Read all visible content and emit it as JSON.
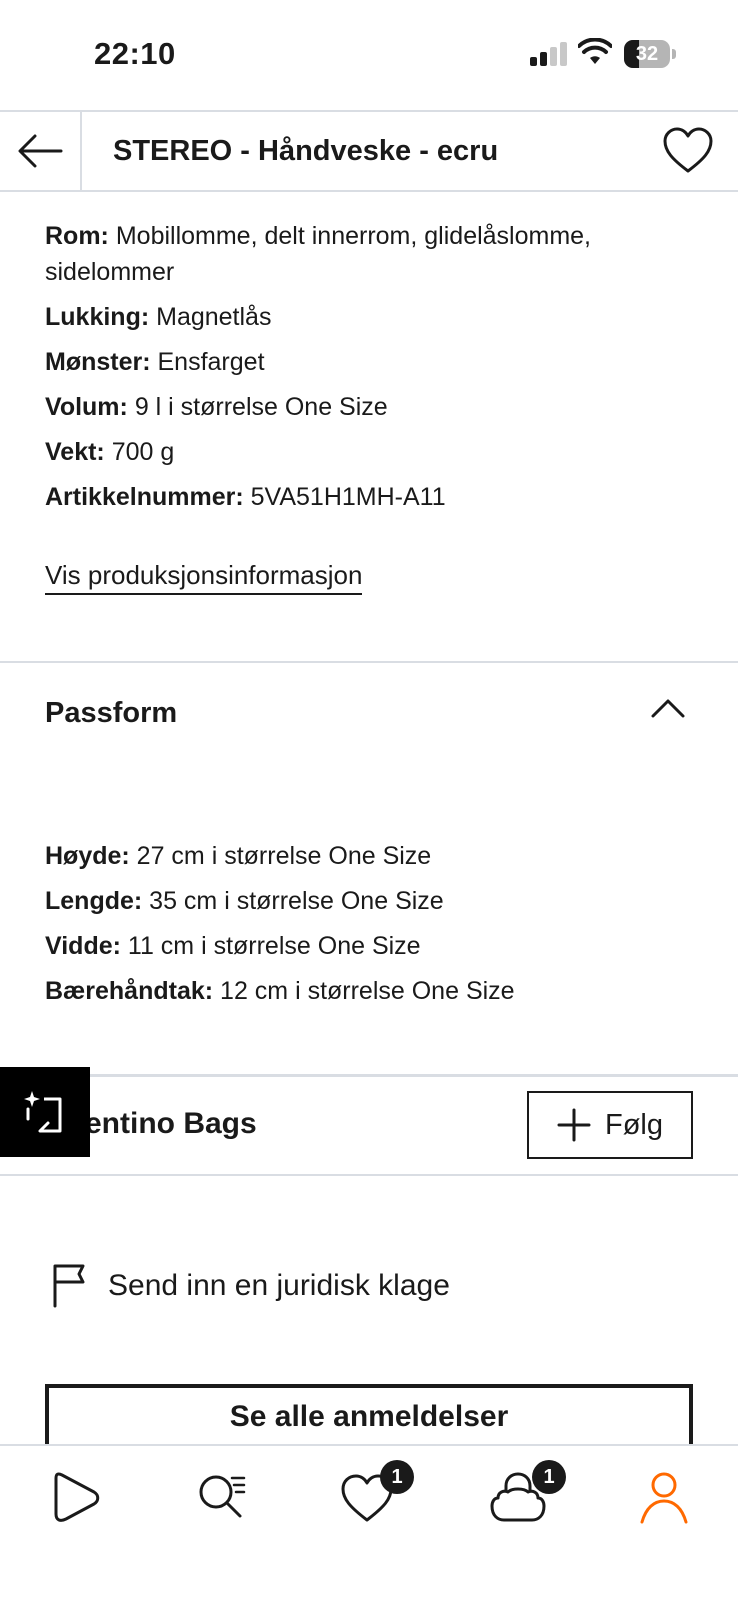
{
  "status_bar": {
    "time": "22:10",
    "battery": "32",
    "battery_level": 0.32
  },
  "header": {
    "title": "STEREO - Håndveske - ecru"
  },
  "details": [
    {
      "label": "Rom:",
      "value": " Mobillomme, delt innerrom, glidelåslomme, sidelommer"
    },
    {
      "label": "Lukking:",
      "value": " Magnetlås"
    },
    {
      "label": "Mønster:",
      "value": " Ensfarget"
    },
    {
      "label": "Volum:",
      "value": " 9 l i størrelse One Size"
    },
    {
      "label": "Vekt:",
      "value": " 700 g"
    },
    {
      "label": "Artikkelnummer:",
      "value": " 5VA51H1MH-A11"
    }
  ],
  "production_link": "Vis produksjonsinformasjon",
  "fit_section": {
    "title": "Passform",
    "items": [
      {
        "label": "Høyde:",
        "value": " 27 cm i størrelse One Size"
      },
      {
        "label": "Lengde:",
        "value": " 35 cm i størrelse One Size"
      },
      {
        "label": "Vidde:",
        "value": " 11 cm i størrelse One Size"
      },
      {
        "label": "Bærehåndtak:",
        "value": " 12 cm i størrelse One Size"
      }
    ]
  },
  "brand": {
    "name": "entino Bags",
    "follow_label": "Følg"
  },
  "report": {
    "label": "Send inn en juridisk klage"
  },
  "reviews_button": "Se alle anmeldelser",
  "tabbar": {
    "wishlist_badge": "1",
    "cart_badge": "1",
    "accent": "#ff6900"
  }
}
